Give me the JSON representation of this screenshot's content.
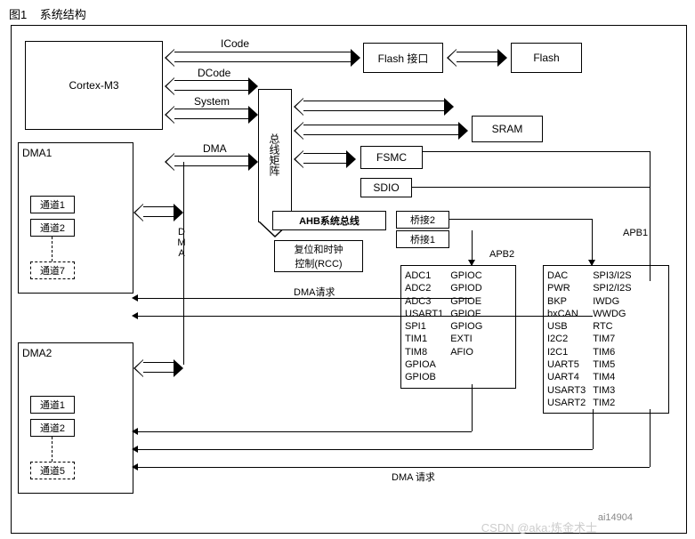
{
  "fig": {
    "num": "图1",
    "title": "系统结构"
  },
  "cpu": "Cortex-M3",
  "buses": {
    "icode": "ICode",
    "dcode": "DCode",
    "system": "System",
    "dma": "DMA"
  },
  "busmatrix": "总线矩阵",
  "flash_if": "Flash 接口",
  "flash": "Flash",
  "sram": "SRAM",
  "fsmc": "FSMC",
  "sdio": "SDIO",
  "ahb": "AHB系统总线",
  "bridge1": "桥接1",
  "bridge2": "桥接2",
  "rcc": "复位和时钟\n控制(RCC)",
  "dma1": {
    "title": "DMA1",
    "ch1": "通道1",
    "ch2": "通道2",
    "ch7": "通道7"
  },
  "dma2": {
    "title": "DMA2",
    "ch1": "通道1",
    "ch2": "通道2",
    "ch5": "通道5"
  },
  "dma_label": "DMA",
  "dma_req": "DMA请求",
  "dma_req2": "DMA 请求",
  "apb1": "APB1",
  "apb2": "APB2",
  "apb2_left": [
    "ADC1",
    "ADC2",
    "ADC3",
    "USART1",
    "SPI1",
    "TIM1",
    "TIM8",
    "GPIOA",
    "GPIOB"
  ],
  "apb2_right": [
    "GPIOC",
    "GPIOD",
    "GPIOE",
    "GPIOF",
    "GPIOG",
    "EXTI",
    "AFIO"
  ],
  "apb1_left": [
    "DAC",
    "PWR",
    "BKP",
    "bxCAN",
    "USB",
    "I2C2",
    "I2C1",
    "UART5",
    "UART4",
    "USART3",
    "USART2"
  ],
  "apb1_right": [
    "SPI3/I2S",
    "SPI2/I2S",
    "IWDG",
    "WWDG",
    "RTC",
    "TIM7",
    "TIM6",
    "TIM5",
    "TIM4",
    "TIM3",
    "TIM2"
  ],
  "wm": "CSDN @aka:炼金术士",
  "wm2": "ai14904"
}
